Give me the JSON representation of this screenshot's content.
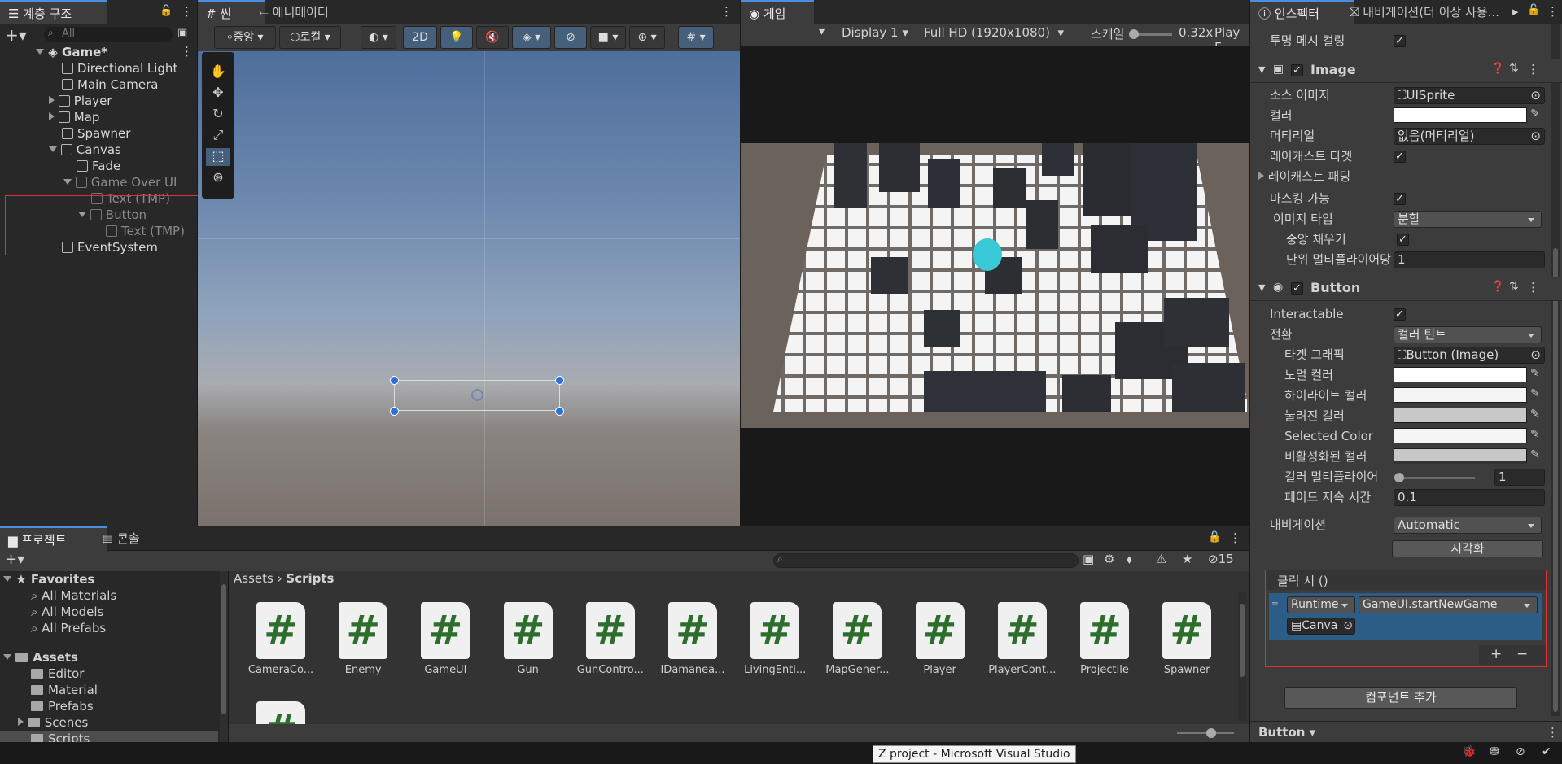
{
  "hierarchy": {
    "tab": "계층 구조",
    "search_placeholder": "All",
    "scene": "Game*",
    "items": [
      {
        "label": "Directional Light",
        "dim": false
      },
      {
        "label": "Main Camera",
        "dim": false
      },
      {
        "label": "Player",
        "dim": false
      },
      {
        "label": "Map",
        "dim": false
      },
      {
        "label": "Spawner",
        "dim": false
      },
      {
        "label": "Canvas",
        "dim": false
      },
      {
        "label": "Fade",
        "dim": false
      },
      {
        "label": "Game Over UI",
        "dim": true
      },
      {
        "label": "Text (TMP)",
        "dim": true
      },
      {
        "label": "Button",
        "dim": true
      },
      {
        "label": "Text (TMP)",
        "dim": true
      },
      {
        "label": "EventSystem",
        "dim": false
      }
    ]
  },
  "scene_view": {
    "tab_scene": "씬",
    "tab_animator": "애니메이터",
    "pivot": "중앙",
    "space": "로컬",
    "mode_2d": "2D"
  },
  "game_view": {
    "tab": "게임",
    "display": "Display 1",
    "resolution": "Full HD (1920x1080)",
    "scale_label": "스케일",
    "scale_value": "0.32x",
    "play_label": "Play F"
  },
  "inspector": {
    "tab_inspector": "인스펙터",
    "tab_navigation": "내비게이션(더 이상 사용...",
    "cull_transparent": "투명 메시 컬링",
    "image": {
      "title": "Image",
      "source_label": "소스 이미지",
      "source_value": "UISprite",
      "color_label": "컬러",
      "material_label": "머티리얼",
      "material_value": "없음(머티리얼)",
      "raycast_target": "레이캐스트 타겟",
      "raycast_padding": "레이캐스트 패딩",
      "maskable": "마스킹 가능",
      "image_type_label": "이미지 타입",
      "image_type_value": "분할",
      "fill_center": "중앙 채우기",
      "ppu_label": "단위 멀티플라이어당",
      "ppu_value": "1"
    },
    "button": {
      "title": "Button",
      "interactable": "Interactable",
      "transition_label": "전환",
      "transition_value": "컬러 틴트",
      "target_graphic_label": "타겟 그래픽",
      "target_graphic_value": "Button (Image)",
      "normal_color": "노멀 컬러",
      "highlight_color": "하이라이트 컬러",
      "pressed_color": "눌려진 컬러",
      "selected_color": "Selected Color",
      "disabled_color": "비활성화된 컬러",
      "color_multiplier": "컬러 멀티플라이어",
      "color_multiplier_value": "1",
      "fade_duration": "페이드 지속 시간",
      "fade_value": "0.1",
      "navigation_label": "내비게이션",
      "navigation_value": "Automatic",
      "visualize": "시각화",
      "onclick": "클릭 시 ()",
      "runtime": "Runtime",
      "function": "GameUI.startNewGame",
      "object": "Canva",
      "plus": "+",
      "minus": "−"
    },
    "add_component": "컴포넌트 추가",
    "footer": "Button"
  },
  "project": {
    "tab_project": "프로젝트",
    "tab_console": "콘솔",
    "hidden_count": "15",
    "breadcrumb_root": "Assets",
    "breadcrumb_current": "Scripts",
    "favorites": "Favorites",
    "fav_items": [
      "All Materials",
      "All Models",
      "All Prefabs"
    ],
    "assets": "Assets",
    "folders": [
      "Editor",
      "Material",
      "Prefabs",
      "Scenes",
      "Scripts"
    ],
    "scripts": [
      "CameraCo...",
      "Enemy",
      "GameUI",
      "Gun",
      "GunContro...",
      "IDamanea...",
      "LivingEnti...",
      "MapGener...",
      "Player",
      "PlayerCont...",
      "Projectile",
      "Spawner"
    ]
  },
  "taskbar": {
    "tooltip": "Z project - Microsoft Visual Studio"
  },
  "colors": {
    "accent": "#4a90e2",
    "highlight_red": "#e03030",
    "selected_row": "#2c5d87"
  }
}
